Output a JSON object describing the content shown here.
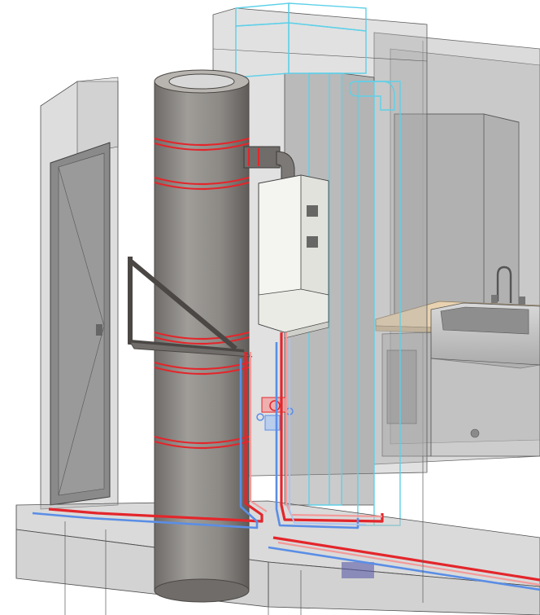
{
  "scene": {
    "description_type": "isometric-mep-model",
    "colors": {
      "background": "#ffffff",
      "glass": "#9e9e9e",
      "glass_edge": "#5c5c5c",
      "duct_edge": "#5fd0e8",
      "hot_pipe": "#e3262b",
      "hot_pipe_light": "#f39a9a",
      "cold_pipe": "#5a8ee6",
      "cold_pipe_light": "#a8c4f2",
      "chimney": "#8f8c88",
      "chimney_dark": "#6f6c69",
      "boiler": "#f4f4f0",
      "counter": "#e8d2b0",
      "sink": "#cfcfcf",
      "door": "#8a8a8a"
    },
    "boiler": {
      "labels": [
        "",
        ""
      ]
    }
  }
}
